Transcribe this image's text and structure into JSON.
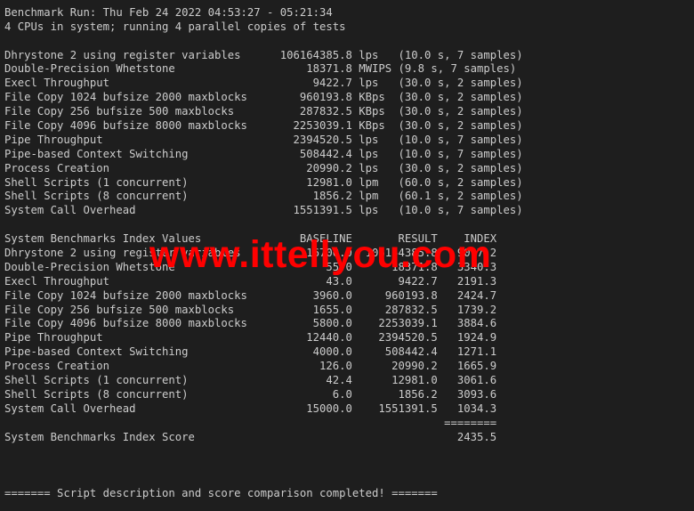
{
  "terminal": {
    "separator_top": "------------------------------------------------------------------------",
    "header": {
      "run_line": "Benchmark Run: Thu Feb 24 2022 04:53:27 - 05:21:34",
      "cpu_line": "4 CPUs in system; running 4 parallel copies of tests"
    },
    "raw_results": [
      {
        "name": "Dhrystone 2 using register variables",
        "value": "106164385.8",
        "unit": "lps",
        "time": "10.0 s",
        "samples": "7 samples"
      },
      {
        "name": "Double-Precision Whetstone",
        "value": "18371.8",
        "unit": "MWIPS",
        "time": "9.8 s",
        "samples": "7 samples"
      },
      {
        "name": "Execl Throughput",
        "value": "9422.7",
        "unit": "lps",
        "time": "30.0 s",
        "samples": "2 samples"
      },
      {
        "name": "File Copy 1024 bufsize 2000 maxblocks",
        "value": "960193.8",
        "unit": "KBps",
        "time": "30.0 s",
        "samples": "2 samples"
      },
      {
        "name": "File Copy 256 bufsize 500 maxblocks",
        "value": "287832.5",
        "unit": "KBps",
        "time": "30.0 s",
        "samples": "2 samples"
      },
      {
        "name": "File Copy 4096 bufsize 8000 maxblocks",
        "value": "2253039.1",
        "unit": "KBps",
        "time": "30.0 s",
        "samples": "2 samples"
      },
      {
        "name": "Pipe Throughput",
        "value": "2394520.5",
        "unit": "lps",
        "time": "10.0 s",
        "samples": "7 samples"
      },
      {
        "name": "Pipe-based Context Switching",
        "value": "508442.4",
        "unit": "lps",
        "time": "10.0 s",
        "samples": "7 samples"
      },
      {
        "name": "Process Creation",
        "value": "20990.2",
        "unit": "lps",
        "time": "30.0 s",
        "samples": "2 samples"
      },
      {
        "name": "Shell Scripts (1 concurrent)",
        "value": "12981.0",
        "unit": "lpm",
        "time": "60.0 s",
        "samples": "2 samples"
      },
      {
        "name": "Shell Scripts (8 concurrent)",
        "value": "1856.2",
        "unit": "lpm",
        "time": "60.1 s",
        "samples": "2 samples"
      },
      {
        "name": "System Call Overhead",
        "value": "1551391.5",
        "unit": "lps",
        "time": "10.0 s",
        "samples": "7 samples"
      }
    ],
    "index_table": {
      "title": "System Benchmarks Index Values",
      "columns": [
        "BASELINE",
        "RESULT",
        "INDEX"
      ],
      "rows": [
        {
          "name": "Dhrystone 2 using register variables",
          "baseline": "116700.0",
          "result": "106164385.8",
          "index": "9097.2"
        },
        {
          "name": "Double-Precision Whetstone",
          "baseline": "55.0",
          "result": "18371.8",
          "index": "3340.3"
        },
        {
          "name": "Execl Throughput",
          "baseline": "43.0",
          "result": "9422.7",
          "index": "2191.3"
        },
        {
          "name": "File Copy 1024 bufsize 2000 maxblocks",
          "baseline": "3960.0",
          "result": "960193.8",
          "index": "2424.7"
        },
        {
          "name": "File Copy 256 bufsize 500 maxblocks",
          "baseline": "1655.0",
          "result": "287832.5",
          "index": "1739.2"
        },
        {
          "name": "File Copy 4096 bufsize 8000 maxblocks",
          "baseline": "5800.0",
          "result": "2253039.1",
          "index": "3884.6"
        },
        {
          "name": "Pipe Throughput",
          "baseline": "12440.0",
          "result": "2394520.5",
          "index": "1924.9"
        },
        {
          "name": "Pipe-based Context Switching",
          "baseline": "4000.0",
          "result": "508442.4",
          "index": "1271.1"
        },
        {
          "name": "Process Creation",
          "baseline": "126.0",
          "result": "20990.2",
          "index": "1665.9"
        },
        {
          "name": "Shell Scripts (1 concurrent)",
          "baseline": "42.4",
          "result": "12981.0",
          "index": "3061.6"
        },
        {
          "name": "Shell Scripts (8 concurrent)",
          "baseline": "6.0",
          "result": "1856.2",
          "index": "3093.6"
        },
        {
          "name": "System Call Overhead",
          "baseline": "15000.0",
          "result": "1551391.5",
          "index": "1034.3"
        }
      ],
      "total_separator": "========",
      "score_label": "System Benchmarks Index Score",
      "score": "2435.5"
    },
    "footer": "======= Script description and score comparison completed! ======="
  },
  "watermark": "www.ittellyou.com"
}
